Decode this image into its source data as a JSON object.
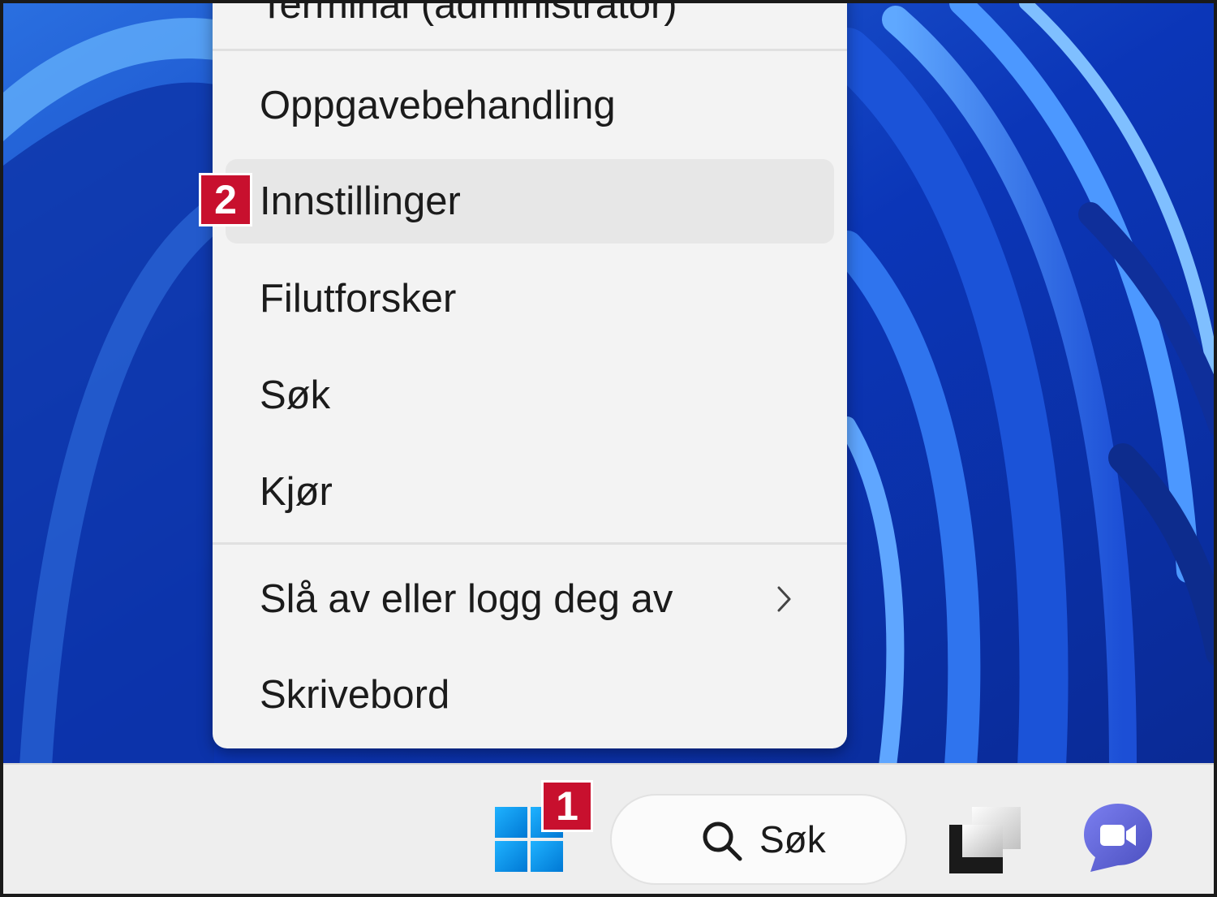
{
  "menu": {
    "items": [
      {
        "id": "terminal",
        "label": "Terminal (administrator)"
      },
      {
        "id": "task-manager",
        "label": "Oppgavebehandling"
      },
      {
        "id": "settings",
        "label": "Innstillinger"
      },
      {
        "id": "file-explorer",
        "label": "Filutforsker"
      },
      {
        "id": "search",
        "label": "Søk"
      },
      {
        "id": "run",
        "label": "Kjør"
      },
      {
        "id": "shutdown",
        "label": "Slå av eller logg deg av"
      },
      {
        "id": "desktop",
        "label": "Skrivebord"
      }
    ]
  },
  "badges": {
    "start": "1",
    "settings": "2"
  },
  "taskbar": {
    "search_label": "Søk"
  },
  "colors": {
    "badge": "#c8102e",
    "windows_logo": "#0a8fe0",
    "wallpaper": "#0a2fa8",
    "chat": "#5b5fc7"
  },
  "icons": [
    "windows-start-icon",
    "search-icon",
    "task-view-icon",
    "teams-chat-icon",
    "chevron-right-icon"
  ]
}
